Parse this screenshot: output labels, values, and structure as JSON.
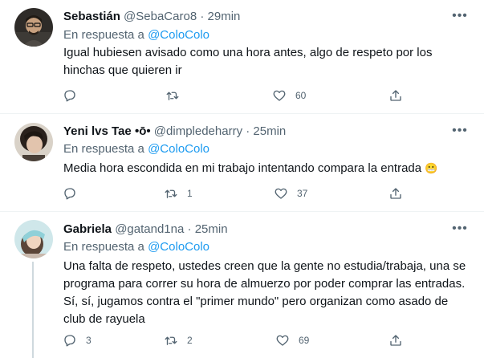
{
  "tweets": [
    {
      "name": "Sebastián",
      "badge": "",
      "handle": "@SebaCaro8",
      "time": "29min",
      "reply_prefix": "En respuesta a",
      "reply_mention": "@ColoColo",
      "text": "Igual hubiesen avisado como una hora antes, algo de respeto por los hinchas que quieren ir",
      "emoji": "",
      "replies": "",
      "retweets": "",
      "likes": "60"
    },
    {
      "name": "Yeni lvs Tae",
      "badge": "•ō•",
      "handle": "@dimpledeharry",
      "time": "25min",
      "reply_prefix": "En respuesta a",
      "reply_mention": "@ColoColo",
      "text": "Media hora escondida en mi trabajo intentando compara la entrada",
      "emoji": "😬",
      "replies": "",
      "retweets": "1",
      "likes": "37"
    },
    {
      "name": "Gabriela",
      "badge": "",
      "handle": "@gatand1na",
      "time": "25min",
      "reply_prefix": "En respuesta a",
      "reply_mention": "@ColoColo",
      "text": "Una falta de respeto, ustedes creen que la gente no estudia/trabaja, una se programa para correr su hora de almuerzo por poder comprar las entradas. Sí, sí, jugamos contra el \"primer mundo\" pero organizan como asado de club de rayuela",
      "emoji": "",
      "replies": "3",
      "retweets": "2",
      "likes": "69"
    }
  ],
  "separator": "·",
  "icons": [
    "more-icon",
    "reply-icon",
    "retweet-icon",
    "like-icon",
    "share-icon"
  ],
  "colors": {
    "mention": "#1d9bf0",
    "secondary": "#536471",
    "text": "#0f1419",
    "divider": "#eff3f4"
  }
}
